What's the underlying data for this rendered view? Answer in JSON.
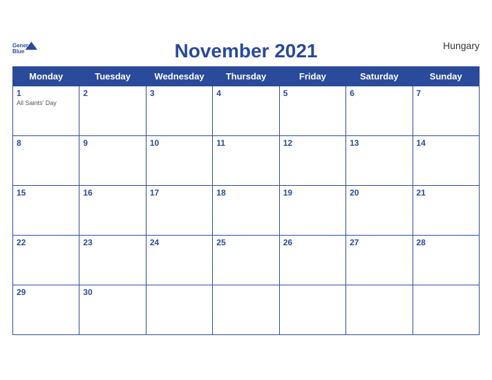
{
  "header": {
    "title": "November 2021",
    "country": "Hungary",
    "logo_line1": "General",
    "logo_line2": "Blue"
  },
  "days_of_week": [
    "Monday",
    "Tuesday",
    "Wednesday",
    "Thursday",
    "Friday",
    "Saturday",
    "Sunday"
  ],
  "weeks": [
    [
      {
        "day": "1",
        "holiday": "All Saints' Day"
      },
      {
        "day": "2",
        "holiday": ""
      },
      {
        "day": "3",
        "holiday": ""
      },
      {
        "day": "4",
        "holiday": ""
      },
      {
        "day": "5",
        "holiday": ""
      },
      {
        "day": "6",
        "holiday": ""
      },
      {
        "day": "7",
        "holiday": ""
      }
    ],
    [
      {
        "day": "8",
        "holiday": ""
      },
      {
        "day": "9",
        "holiday": ""
      },
      {
        "day": "10",
        "holiday": ""
      },
      {
        "day": "11",
        "holiday": ""
      },
      {
        "day": "12",
        "holiday": ""
      },
      {
        "day": "13",
        "holiday": ""
      },
      {
        "day": "14",
        "holiday": ""
      }
    ],
    [
      {
        "day": "15",
        "holiday": ""
      },
      {
        "day": "16",
        "holiday": ""
      },
      {
        "day": "17",
        "holiday": ""
      },
      {
        "day": "18",
        "holiday": ""
      },
      {
        "day": "19",
        "holiday": ""
      },
      {
        "day": "20",
        "holiday": ""
      },
      {
        "day": "21",
        "holiday": ""
      }
    ],
    [
      {
        "day": "22",
        "holiday": ""
      },
      {
        "day": "23",
        "holiday": ""
      },
      {
        "day": "24",
        "holiday": ""
      },
      {
        "day": "25",
        "holiday": ""
      },
      {
        "day": "26",
        "holiday": ""
      },
      {
        "day": "27",
        "holiday": ""
      },
      {
        "day": "28",
        "holiday": ""
      }
    ],
    [
      {
        "day": "29",
        "holiday": ""
      },
      {
        "day": "30",
        "holiday": ""
      },
      {
        "day": "",
        "holiday": ""
      },
      {
        "day": "",
        "holiday": ""
      },
      {
        "day": "",
        "holiday": ""
      },
      {
        "day": "",
        "holiday": ""
      },
      {
        "day": "",
        "holiday": ""
      }
    ]
  ]
}
